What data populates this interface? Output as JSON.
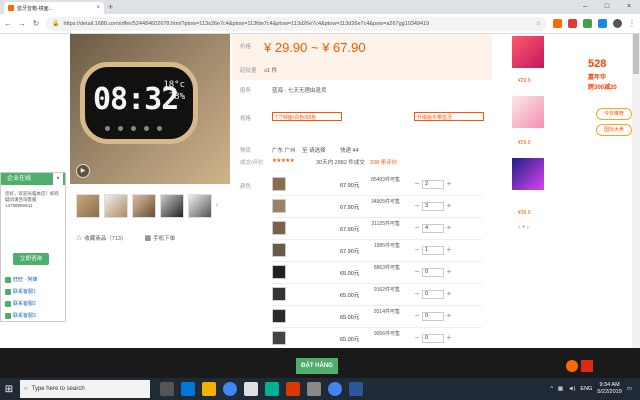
{
  "browser": {
    "tab_title": "蓝牙音箱-镜面...",
    "tab_close": "×",
    "new_tab": "+",
    "win_min": "–",
    "win_max": "□",
    "win_close": "×",
    "url": "https://detail.1688.com/offer/524484602678.html?ptow=113s26e7c4&ptow=113fde7c4&ptow=113d26e7c4&ptow=113d26e7c4&pow=a267gg10349419"
  },
  "product": {
    "clock_digits": "08:32",
    "clock_temp": "18°c",
    "clock_humidity": "78%",
    "price": "¥ 29.90 ~ ¥ 67.90",
    "price_label": "价格",
    "moq_label": "起批量",
    "moq": "≥1 件",
    "service_label": "服务",
    "service_text": "蓝海 · 七天无理由退货",
    "logistics_label": "物流",
    "origin": "广东 广州",
    "logistics_to": "至  请选择",
    "shipping": "快递 ¥4",
    "rating_label": "成交/评价",
    "rating_stars": "★★★★★",
    "deals": "30天内 2882 件成交",
    "reviews": "238 条评价",
    "color_label": "颜色",
    "sel_label": "规格",
    "sel_box1": "7寸钟面/白色/68色",
    "sel_box2": "升级版不带蓝牙",
    "fav_label": "收藏商品（713）",
    "phone_label": "手机下单"
  },
  "table_rows": [
    {
      "price": "67.90元",
      "stock": "85493件可售",
      "qty": "2"
    },
    {
      "price": "67.90元",
      "stock": "34905件可售",
      "qty": "3"
    },
    {
      "price": "67.90元",
      "stock": "31125件可售",
      "qty": "4"
    },
    {
      "price": "67.90元",
      "stock": "1985件可售",
      "qty": "1"
    },
    {
      "price": "65.00元",
      "stock": "8863件可售",
      "qty": "0"
    },
    {
      "price": "65.00元",
      "stock": "9162件可售",
      "qty": "0"
    },
    {
      "price": "65.00元",
      "stock": "9314件可售",
      "qty": "0"
    },
    {
      "price": "65.00元",
      "stock": "9056件可售",
      "qty": "0"
    }
  ],
  "right_items": [
    {
      "price": "¥29.9"
    },
    {
      "price": "¥29.9"
    },
    {
      "price": "¥39.9"
    }
  ],
  "promo": {
    "big": "528",
    "line1": "嘉年华",
    "line2": "跨300减20",
    "btn1": "今日推荐",
    "btn2": "国际大卖"
  },
  "qq": {
    "title": "企业在线",
    "close": "×",
    "body": "您好，欢迎光临本店！如有疑问请咨询客服 13798855641",
    "btn": "立即咨询",
    "links": [
      "旺旺 · 阿峰",
      "联系客服1",
      "联系客服2",
      "联系客服3"
    ]
  },
  "bottom": {
    "order_btn": "ĐẶT HÀNG"
  },
  "taskbar": {
    "search_placeholder": "Type here to search",
    "lang": "ENG",
    "time": "9:34 AM",
    "date": "5/22/2019"
  },
  "colors": {
    "accent": "#ff5500",
    "green": "#4fae6b"
  }
}
